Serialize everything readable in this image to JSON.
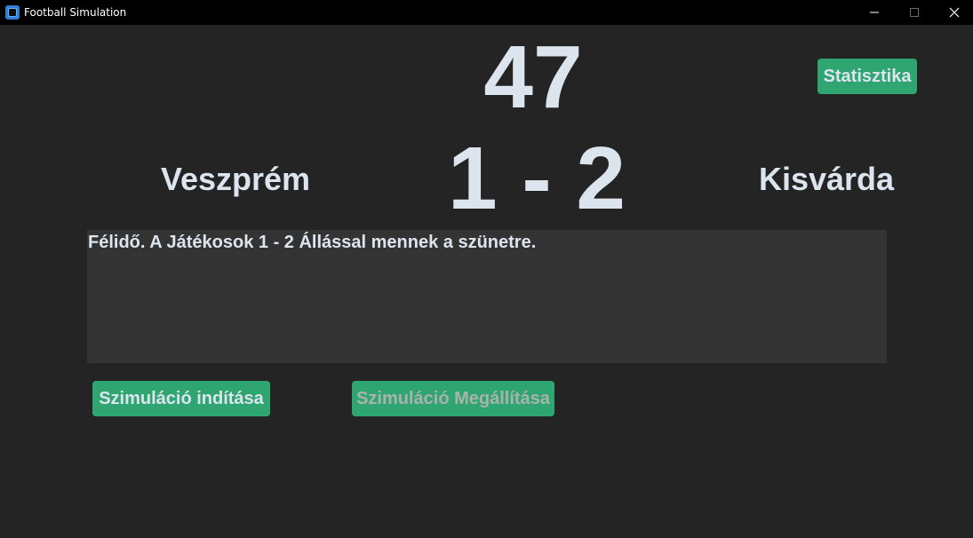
{
  "window": {
    "title": "Football Simulation",
    "icon": "app-window-icon",
    "controls": [
      "minimize-icon",
      "maximize-icon",
      "close-icon"
    ]
  },
  "match": {
    "minute": "47",
    "home_team": "Veszprém",
    "away_team": "Kisvárda",
    "score": "1 - 2"
  },
  "toolbar": {
    "stats_label": "Statisztika"
  },
  "commentary": {
    "text": "Félidő. A Játékosok 1 - 2 Állással mennek a szünetre."
  },
  "controls": {
    "start_label": "Szimuláció indítása",
    "stop_label": "Szimuláció Megállítása",
    "stop_disabled": true
  },
  "colors": {
    "background": "#242424",
    "text_box": "#333333",
    "accent_green": "#2fa572",
    "text": "#dce4ee",
    "disabled_text": "#a8b3ad",
    "titlebar": "#000000"
  }
}
